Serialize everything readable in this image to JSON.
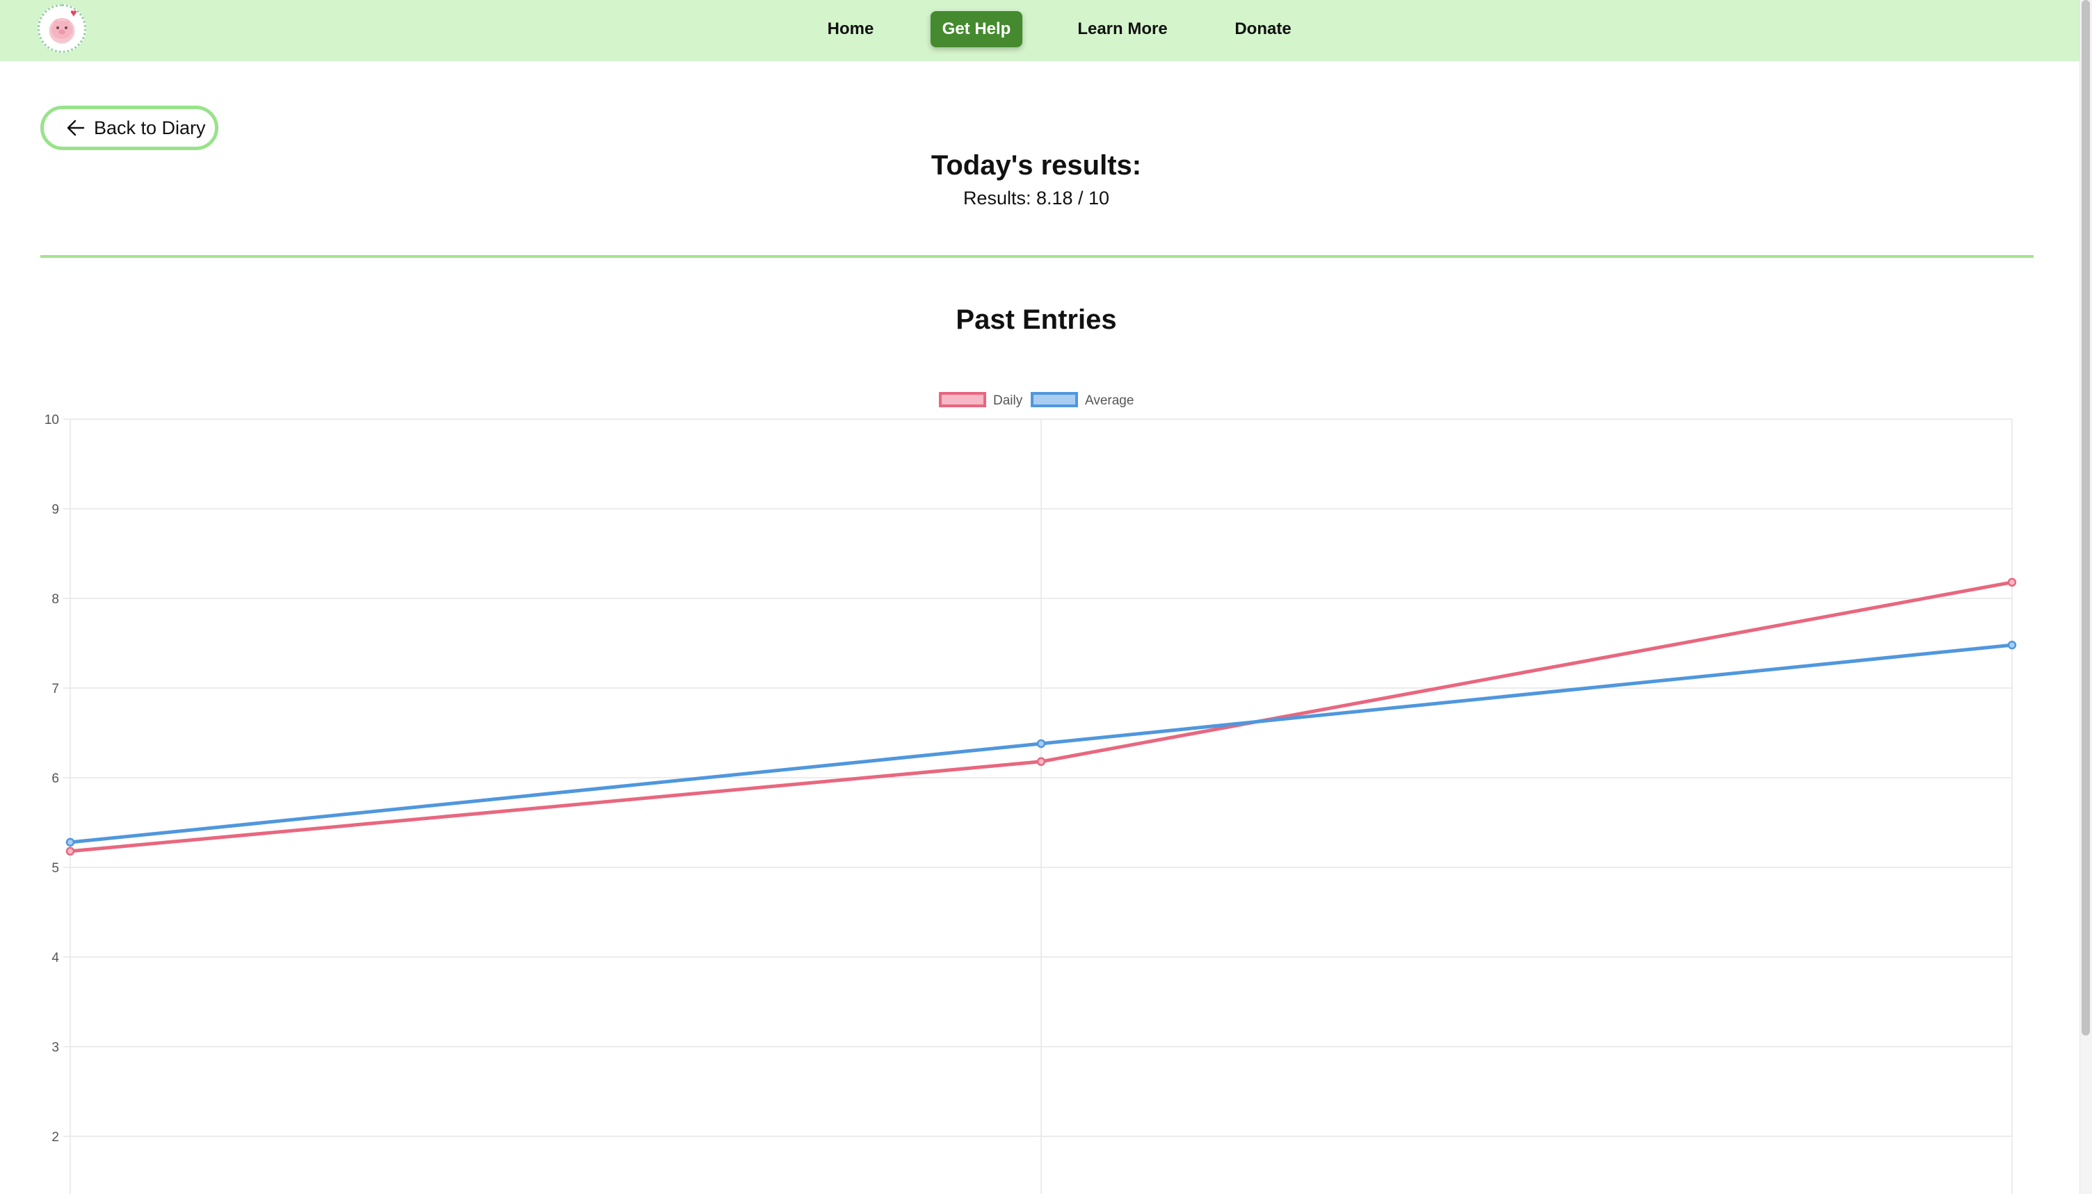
{
  "nav": {
    "items": [
      {
        "label": "Home"
      },
      {
        "label": "Get Help"
      },
      {
        "label": "Learn More"
      },
      {
        "label": "Donate"
      }
    ],
    "active": "Get Help",
    "background": "#d4f4cc",
    "active_color": "#458a2f"
  },
  "back_button": {
    "label": "Back to Diary",
    "icon": "arrow-left-icon"
  },
  "results": {
    "title": "Today's results:",
    "text": "Results: 8.18 / 10"
  },
  "past_entries": {
    "title": "Past Entries"
  },
  "chart_data": {
    "type": "line",
    "x": [
      0,
      1,
      2
    ],
    "series": [
      {
        "name": "Daily",
        "values": [
          5.18,
          6.18,
          8.18
        ],
        "color": "#e8677f",
        "fill": "#f7b8c5"
      },
      {
        "name": "Average",
        "values": [
          5.28,
          6.38,
          7.48
        ],
        "color": "#4f97dd",
        "fill": "#a9cdf1"
      }
    ],
    "ylim": [
      2,
      10
    ],
    "yticks": [
      "10",
      "9",
      "8",
      "7",
      "6",
      "5",
      "4",
      "3",
      "2"
    ],
    "legend": "top-center",
    "grid": true
  }
}
